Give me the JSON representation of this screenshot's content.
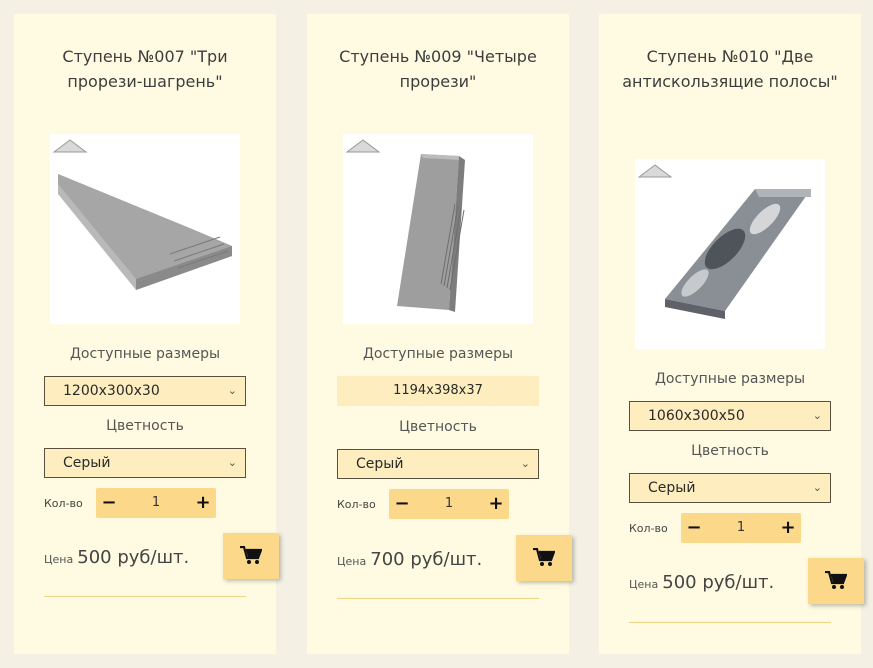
{
  "products": [
    {
      "title": "Ступень №007 \"Три прорези-шагрень\"",
      "sizes_label": "Доступные размеры",
      "size": "1200x300x30",
      "color_label": "Цветность",
      "color": "Серый",
      "qty_label": "Кол-во",
      "qty": "1",
      "price_label": "Цена",
      "price": "500 руб/шт."
    },
    {
      "title": "Ступень №009 \"Четыре прорези\"",
      "sizes_label": "Доступные размеры",
      "size": "1194x398x37",
      "color_label": "Цветность",
      "color": "Серый",
      "qty_label": "Кол-во",
      "qty": "1",
      "price_label": "Цена",
      "price": "700 руб/шт."
    },
    {
      "title": "Ступень №010 \"Две антискользящие полосы\"",
      "sizes_label": "Доступные размеры",
      "size": "1060x300x50",
      "color_label": "Цветность",
      "color": "Серый",
      "qty_label": "Кол-во",
      "qty": "1",
      "price_label": "Цена",
      "price": "500 руб/шт."
    }
  ],
  "icons": {
    "minus": "−",
    "plus": "+",
    "chevron": "⌄",
    "cart": "cart-icon"
  }
}
